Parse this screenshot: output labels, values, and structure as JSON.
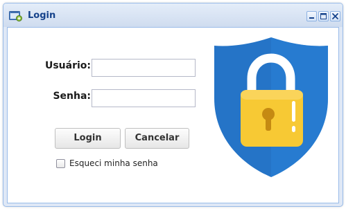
{
  "window": {
    "title": "Login",
    "app_icon": "window-app-icon",
    "controls": [
      "minimize-icon",
      "maximize-icon",
      "close-icon"
    ]
  },
  "form": {
    "username_label": "Usuário:",
    "username_value": "",
    "password_label": "Senha:",
    "password_value": "",
    "login_button": "Login",
    "cancel_button": "Cancelar",
    "forgot_checkbox_label": "Esqueci minha senha",
    "forgot_checked": false
  },
  "illustration": {
    "icon": "shield-lock-icon",
    "colors": {
      "shield": "#2574c7",
      "lock_body": "#f7c934",
      "shackle": "#ffffff",
      "keyhole": "#c58a12"
    }
  },
  "colors": {
    "title_text": "#15428b",
    "frame_border": "#99bbe8",
    "frame_bg": "#dfe8f6"
  }
}
